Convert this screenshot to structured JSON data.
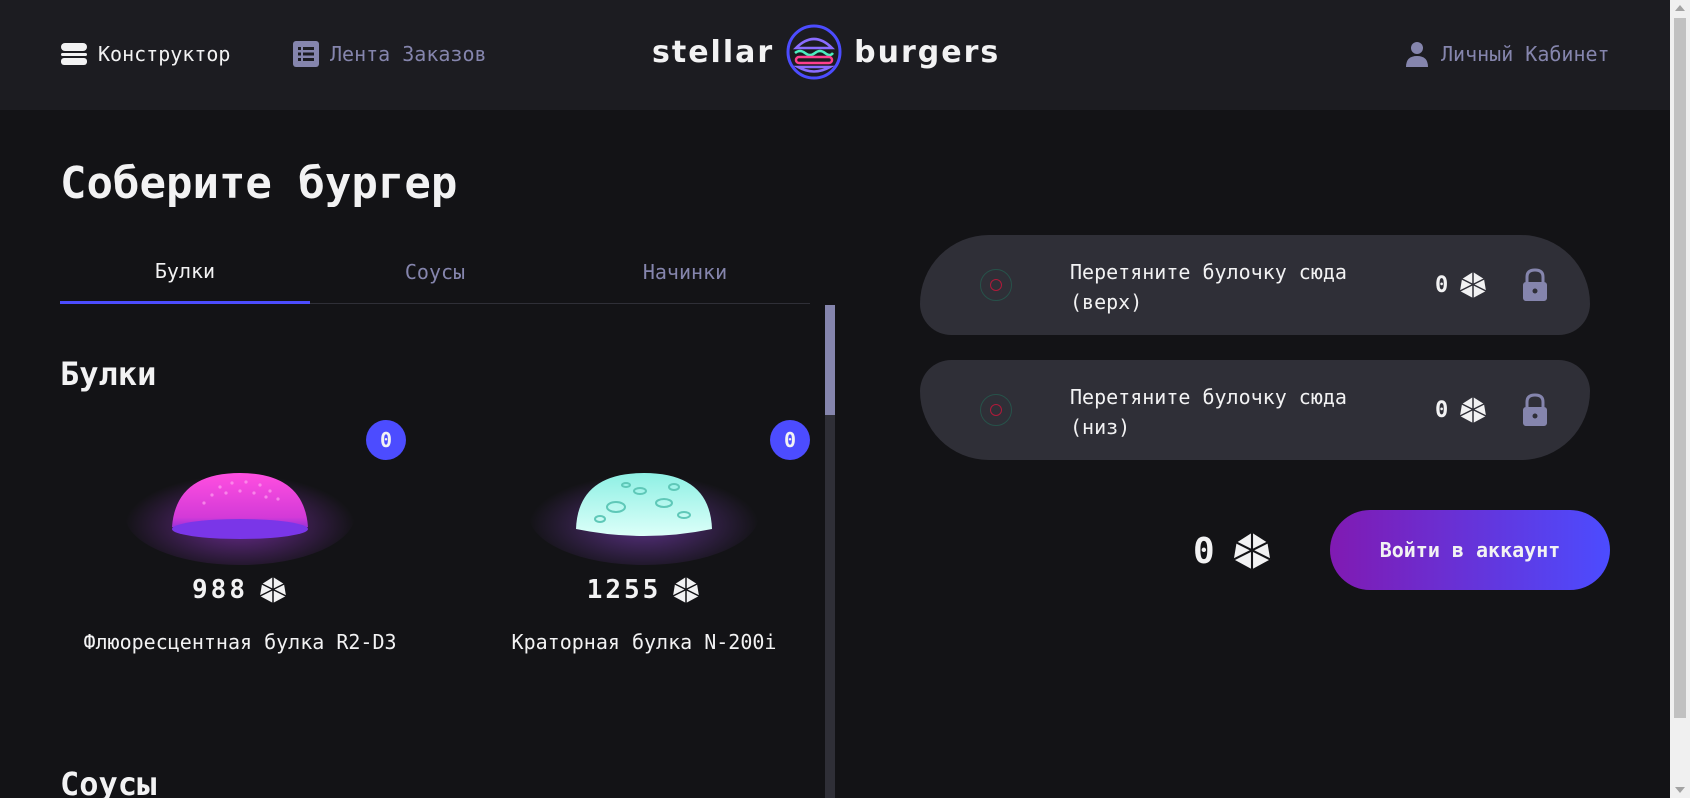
{
  "header": {
    "nav": {
      "constructor": "Конструктор",
      "feed": "Лента Заказов",
      "profile": "Личный Кабинет"
    },
    "logo": {
      "left": "stellar",
      "right": "burgers"
    }
  },
  "page_title": "Соберите бургер",
  "tabs": [
    {
      "label": "Булки",
      "active": true
    },
    {
      "label": "Соусы",
      "active": false
    },
    {
      "label": "Начинки",
      "active": false
    }
  ],
  "sections": {
    "buns": {
      "title": "Булки",
      "items": [
        {
          "name": "Флюоресцентная булка R2-D3",
          "price": "988",
          "count": "0",
          "color": "#e63fd0"
        },
        {
          "name": "Краторная булка N-200i",
          "price": "1255",
          "count": "0",
          "color": "#9ef5e8"
        }
      ]
    },
    "sauces": {
      "title": "Соусы"
    }
  },
  "constructor": {
    "top": {
      "text": "Перетяните булочку сюда (верх)",
      "price": "0"
    },
    "bottom": {
      "text": "Перетяните булочку сюда (низ)",
      "price": "0"
    },
    "total": "0",
    "login_button": "Войти в аккаунт"
  },
  "colors": {
    "accent": "#4c4cff",
    "background": "#131316",
    "header": "#1c1c21",
    "inactive_text": "#8585ad"
  }
}
